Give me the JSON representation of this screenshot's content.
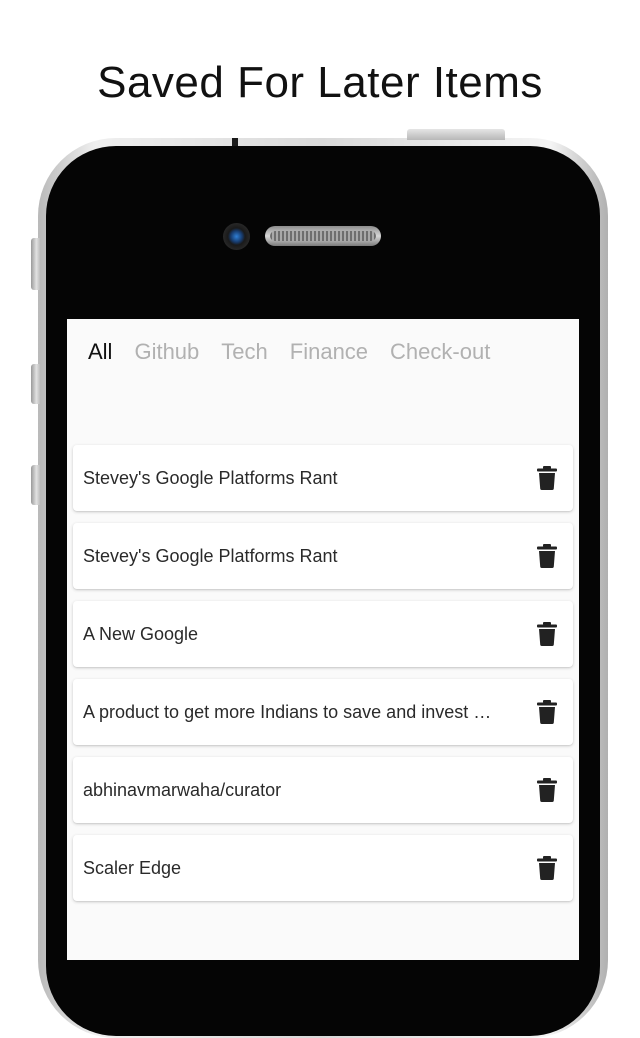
{
  "headline": "Saved For Later Items",
  "tabs": [
    {
      "label": "All",
      "active": true
    },
    {
      "label": "Github",
      "active": false
    },
    {
      "label": "Tech",
      "active": false
    },
    {
      "label": "Finance",
      "active": false
    },
    {
      "label": "Check-out",
      "active": false
    }
  ],
  "items": [
    {
      "title": "Stevey's Google Platforms Rant",
      "action_icon": "trash-icon"
    },
    {
      "title": "Stevey's Google Platforms Rant",
      "action_icon": "trash-icon"
    },
    {
      "title": "A New Google",
      "action_icon": "trash-icon"
    },
    {
      "title": "A product to get more Indians to save and invest …",
      "action_icon": "trash-icon"
    },
    {
      "title": "abhinavmarwaha/curator",
      "action_icon": "trash-icon"
    },
    {
      "title": "Scaler Edge",
      "action_icon": "trash-icon"
    }
  ],
  "colors": {
    "active_tab": "#111111",
    "inactive_tab": "#b1b1b1",
    "screen_bg": "#fafafa",
    "card_bg": "#ffffff",
    "icon": "#222222"
  }
}
